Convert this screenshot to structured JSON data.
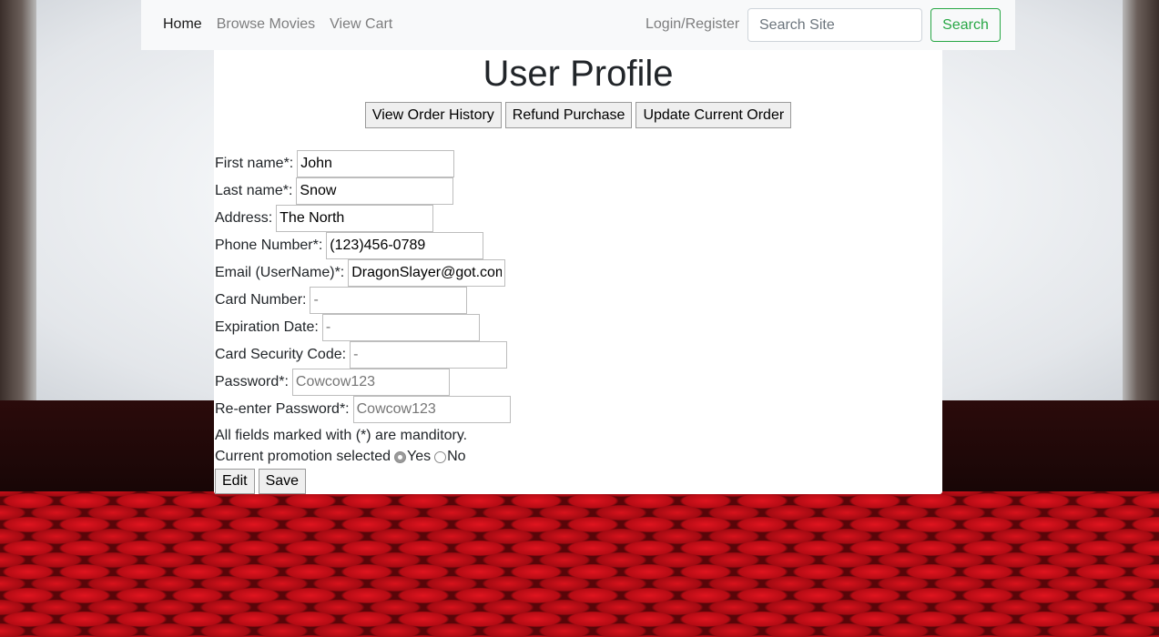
{
  "nav": {
    "links": [
      {
        "label": "Home",
        "active": true
      },
      {
        "label": "Browse Movies",
        "active": false
      },
      {
        "label": "View Cart",
        "active": false
      }
    ],
    "login_label": "Login/Register",
    "search_placeholder": "Search Site",
    "search_button": "Search"
  },
  "page": {
    "title": "User Profile",
    "actions": [
      "View Order History",
      "Refund Purchase",
      "Update Current Order"
    ]
  },
  "form": {
    "fields": [
      {
        "label": "First name*:",
        "value": "John",
        "placeholder": ""
      },
      {
        "label": "Last name*:",
        "value": "Snow",
        "placeholder": ""
      },
      {
        "label": "Address:",
        "value": "The North",
        "placeholder": ""
      },
      {
        "label": "Phone Number*:",
        "value": "(123)456-0789",
        "placeholder": ""
      },
      {
        "label": "Email (UserName)*:",
        "value": "DragonSlayer@got.com",
        "placeholder": ""
      },
      {
        "label": "Card Number:",
        "value": "",
        "placeholder": "-"
      },
      {
        "label": "Expiration Date:",
        "value": "",
        "placeholder": "-"
      },
      {
        "label": "Card Security Code:",
        "value": "",
        "placeholder": "-"
      },
      {
        "label": "Password*:",
        "value": "",
        "placeholder": "Cowcow123"
      },
      {
        "label": "Re-enter Password*:",
        "value": "",
        "placeholder": "Cowcow123"
      }
    ],
    "note": "All fields marked with (*) are manditory.",
    "promo_label": "Current promotion selected",
    "promo_options": [
      {
        "label": "Yes",
        "checked": true
      },
      {
        "label": "No",
        "checked": false
      }
    ],
    "edit_button": "Edit",
    "save_button": "Save"
  },
  "colors": {
    "navbar_bg": "#f8f9fa",
    "search_accent": "#28a745",
    "seat_red": "#c0101a"
  }
}
